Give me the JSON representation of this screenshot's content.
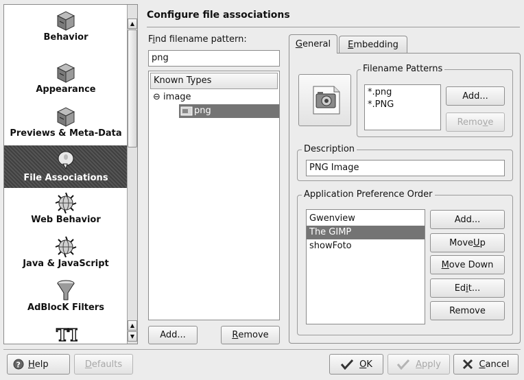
{
  "sidebar": {
    "items": [
      {
        "label": "Behavior",
        "icon": "drawer-icon"
      },
      {
        "label": "Appearance",
        "icon": "drawer-icon"
      },
      {
        "label": "Previews & Meta-Data",
        "icon": "drawer-icon"
      },
      {
        "label": "File Associations",
        "icon": "speech-bubble-icon",
        "selected": true
      },
      {
        "label": "Web Behavior",
        "icon": "globe-gear-icon"
      },
      {
        "label": "Java & JavaScript",
        "icon": "globe-gear-icon"
      },
      {
        "label": "AdBlocK Filters",
        "icon": "funnel-icon"
      },
      {
        "label": "",
        "icon": "fonts-icon"
      }
    ]
  },
  "header": {
    "title": "Configure file associations"
  },
  "find": {
    "label_pre": "F",
    "label_u": "i",
    "label_post": "nd filename pattern:",
    "value": "png"
  },
  "tree": {
    "header": "Known Types",
    "group": "image",
    "child": "png",
    "expander": "⊖"
  },
  "left_buttons": {
    "add": "Add...",
    "remove_u": "R",
    "remove_rest": "emove"
  },
  "tabs": [
    {
      "u": "G",
      "rest": "eneral",
      "active": true
    },
    {
      "u": "E",
      "rest": "mbedding",
      "active": false
    }
  ],
  "filename_patterns": {
    "title": "Filename Patterns",
    "items": [
      "*.png",
      "*.PNG"
    ],
    "add": "Add...",
    "remove_pre": "Remo",
    "remove_u": "v",
    "remove_post": "e"
  },
  "description": {
    "title": "Description",
    "value": "PNG Image"
  },
  "app_pref": {
    "title": "Application Preference Order",
    "items": [
      "Gwenview",
      "The GIMP",
      "showFoto"
    ],
    "selected_index": 1,
    "add": "Add...",
    "move_up_pre": "Move ",
    "move_up_u": "U",
    "move_up_post": "p",
    "move_down_u": "M",
    "move_down_post": "ove Down",
    "edit_pre": "Ed",
    "edit_u": "i",
    "edit_post": "t...",
    "remove": "Remove"
  },
  "bottom": {
    "help_u": "H",
    "help_rest": "elp",
    "defaults_u": "D",
    "defaults_rest": "efaults",
    "ok_u": "O",
    "ok_rest": "K",
    "apply_u": "A",
    "apply_rest": "pply",
    "cancel_u": "C",
    "cancel_rest": "ancel"
  }
}
